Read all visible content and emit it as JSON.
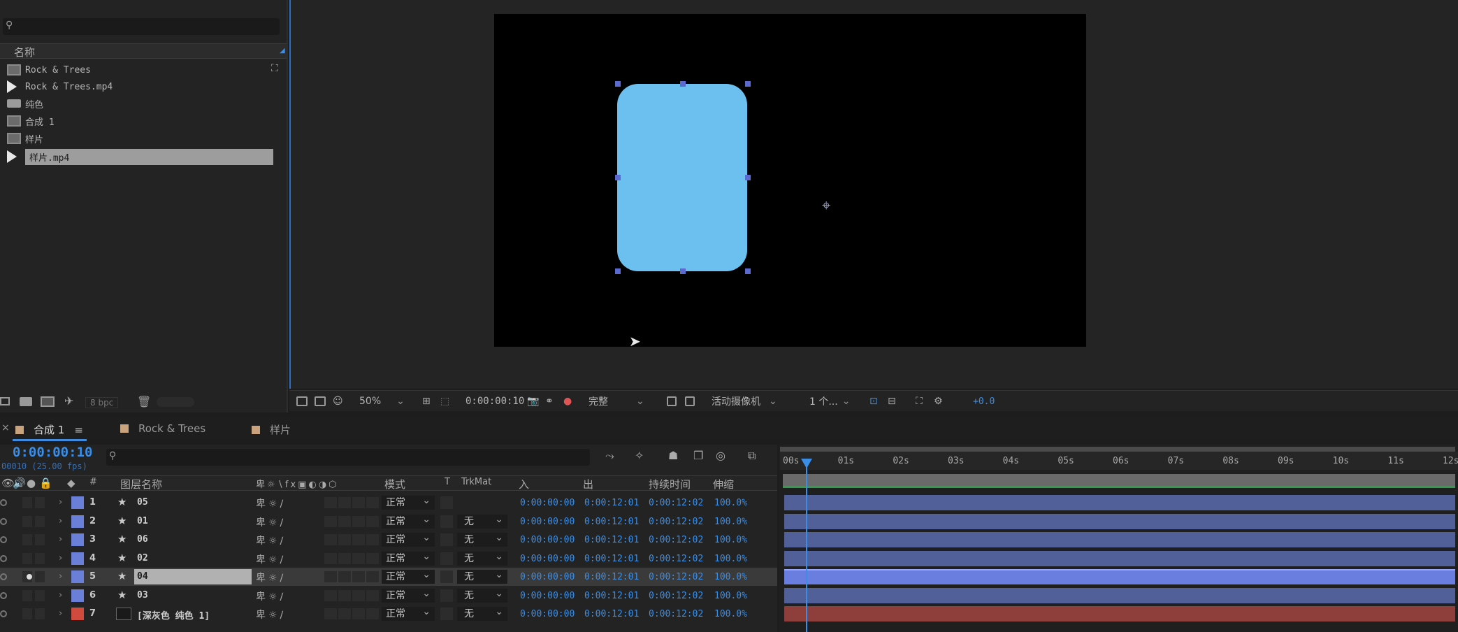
{
  "project": {
    "header_name": "名称",
    "items": [
      {
        "label": "Rock & Trees",
        "type": "comp"
      },
      {
        "label": "Rock & Trees.mp4",
        "type": "footage"
      },
      {
        "label": "纯色",
        "type": "folder"
      },
      {
        "label": "合成 1",
        "type": "comp"
      },
      {
        "label": "样片",
        "type": "comp"
      },
      {
        "label": "样片.mp4",
        "type": "footage",
        "selected": true
      }
    ],
    "bpc": "8 bpc"
  },
  "viewer": {
    "zoom": "50%",
    "timecode": "0:00:00:10",
    "resolution": "完整",
    "camera": "活动摄像机",
    "views": "1 个...",
    "exposure": "+0.0",
    "shape_color": "#6cc0ef"
  },
  "tabs": [
    {
      "label": "合成 1",
      "color": "#c9a27e",
      "active": true
    },
    {
      "label": "Rock & Trees",
      "color": "#c9a27e",
      "active": false
    },
    {
      "label": "样片",
      "color": "#c9a27e",
      "active": false
    }
  ],
  "timeline": {
    "timecode": "0:00:00:10",
    "fps": "00010 (25.00 fps)",
    "columns": {
      "num": "#",
      "layer_name": "图层名称",
      "mode": "模式",
      "t": "T",
      "trkmat": "TrkMat",
      "in": "入",
      "out": "出",
      "duration": "持续时间",
      "stretch": "伸缩"
    },
    "ruler": [
      "00s",
      "01s",
      "02s",
      "03s",
      "04s",
      "05s",
      "06s",
      "07s",
      "08s",
      "09s",
      "10s",
      "11s",
      "12s"
    ],
    "layers": [
      {
        "num": "1",
        "name": "05",
        "color": "#6a7fd8",
        "mode": "正常",
        "trkmat": "",
        "in": "0:00:00:00",
        "out": "0:00:12:01",
        "dur": "0:00:12:02",
        "stretch": "100.0%",
        "bar": "#52609a"
      },
      {
        "num": "2",
        "name": "01",
        "color": "#6a7fd8",
        "mode": "正常",
        "trkmat": "无",
        "in": "0:00:00:00",
        "out": "0:00:12:01",
        "dur": "0:00:12:02",
        "stretch": "100.0%",
        "bar": "#52609a"
      },
      {
        "num": "3",
        "name": "06",
        "color": "#6a7fd8",
        "mode": "正常",
        "trkmat": "无",
        "in": "0:00:00:00",
        "out": "0:00:12:01",
        "dur": "0:00:12:02",
        "stretch": "100.0%",
        "bar": "#52609a"
      },
      {
        "num": "4",
        "name": "02",
        "color": "#6a7fd8",
        "mode": "正常",
        "trkmat": "无",
        "in": "0:00:00:00",
        "out": "0:00:12:01",
        "dur": "0:00:12:02",
        "stretch": "100.0%",
        "bar": "#52609a"
      },
      {
        "num": "5",
        "name": "04",
        "color": "#6a7fd8",
        "mode": "正常",
        "trkmat": "无",
        "in": "0:00:00:00",
        "out": "0:00:12:01",
        "dur": "0:00:12:02",
        "stretch": "100.0%",
        "bar": "#6a7ee0",
        "selected": true
      },
      {
        "num": "6",
        "name": "03",
        "color": "#6a7fd8",
        "mode": "正常",
        "trkmat": "无",
        "in": "0:00:00:00",
        "out": "0:00:12:01",
        "dur": "0:00:12:02",
        "stretch": "100.0%",
        "bar": "#52609a"
      },
      {
        "num": "7",
        "name": "[深灰色 纯色 1]",
        "color": "#d04a3e",
        "mode": "正常",
        "trkmat": "无",
        "in": "0:00:00:00",
        "out": "0:00:12:01",
        "dur": "0:00:12:02",
        "stretch": "100.0%",
        "bar": "#8e3f3b"
      }
    ]
  }
}
